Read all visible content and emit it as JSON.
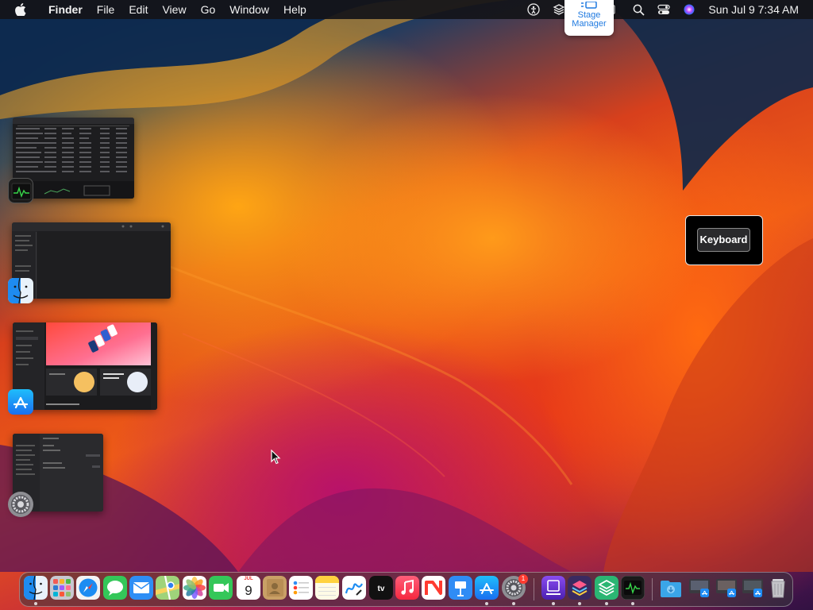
{
  "menubar": {
    "app_name": "Finder",
    "menus": [
      "File",
      "Edit",
      "View",
      "Go",
      "Window",
      "Help"
    ],
    "status_icons": [
      "accessibility-icon",
      "layers-icon",
      "stage-manager-icon",
      "search-icon",
      "control-center-icon",
      "siri-icon"
    ],
    "clock": "Sun Jul 9  7:34 AM"
  },
  "stage_manager_popup": {
    "label_line1": "Stage",
    "label_line2": "Manager"
  },
  "stage_windows": [
    {
      "app": "Activity Monitor",
      "icon": "activity-monitor-icon"
    },
    {
      "app": "Finder",
      "icon": "finder-icon"
    },
    {
      "app": "App Store",
      "icon": "app-store-icon"
    },
    {
      "app": "System Settings",
      "icon": "system-settings-icon"
    }
  ],
  "keyboard_overlay": {
    "button_label": "Keyboard"
  },
  "dock": {
    "apps": [
      {
        "name": "Finder",
        "icon": "finder-icon",
        "running": true
      },
      {
        "name": "Launchpad",
        "icon": "launchpad-icon",
        "running": false
      },
      {
        "name": "Safari",
        "icon": "safari-icon",
        "running": false
      },
      {
        "name": "Messages",
        "icon": "messages-icon",
        "running": false
      },
      {
        "name": "Mail",
        "icon": "mail-icon",
        "running": false
      },
      {
        "name": "Maps",
        "icon": "maps-icon",
        "running": false
      },
      {
        "name": "Photos",
        "icon": "photos-icon",
        "running": false
      },
      {
        "name": "FaceTime",
        "icon": "facetime-icon",
        "running": false
      },
      {
        "name": "Calendar",
        "icon": "calendar-icon",
        "running": false
      },
      {
        "name": "Contacts",
        "icon": "contacts-icon",
        "running": false
      },
      {
        "name": "Reminders",
        "icon": "reminders-icon",
        "running": false
      },
      {
        "name": "Notes",
        "icon": "notes-icon",
        "running": false
      },
      {
        "name": "Freeform",
        "icon": "freeform-icon",
        "running": false
      },
      {
        "name": "TV",
        "icon": "tv-icon",
        "running": false
      },
      {
        "name": "Music",
        "icon": "music-icon",
        "running": false
      },
      {
        "name": "News",
        "icon": "news-icon",
        "running": false
      },
      {
        "name": "Keynote",
        "icon": "keynote-icon",
        "running": false
      },
      {
        "name": "App Store",
        "icon": "app-store-icon",
        "running": true
      },
      {
        "name": "System Settings",
        "icon": "system-settings-icon",
        "running": true
      },
      {
        "name": "Simulator",
        "icon": "simulator-icon",
        "running": true
      },
      {
        "name": "Apple Configurator",
        "icon": "layers-app-icon",
        "running": true
      },
      {
        "name": "Stack App",
        "icon": "stack-app-icon",
        "running": true
      },
      {
        "name": "Activity Monitor",
        "icon": "activity-monitor-icon",
        "running": true
      }
    ],
    "calendar": {
      "month": "JUL",
      "day": "9"
    },
    "settings_badge": "1",
    "right_items": [
      {
        "name": "Downloads",
        "icon": "downloads-folder-icon"
      },
      {
        "name": "App Installer 1",
        "icon": "installer-icon"
      },
      {
        "name": "App Installer 2",
        "icon": "installer-icon"
      },
      {
        "name": "App Installer 3",
        "icon": "installer-icon"
      },
      {
        "name": "Trash",
        "icon": "trash-icon"
      }
    ]
  },
  "colors": {
    "accent": "#1f7ae0",
    "menubar_bg": "#141418",
    "badge_red": "#ff3b30"
  }
}
